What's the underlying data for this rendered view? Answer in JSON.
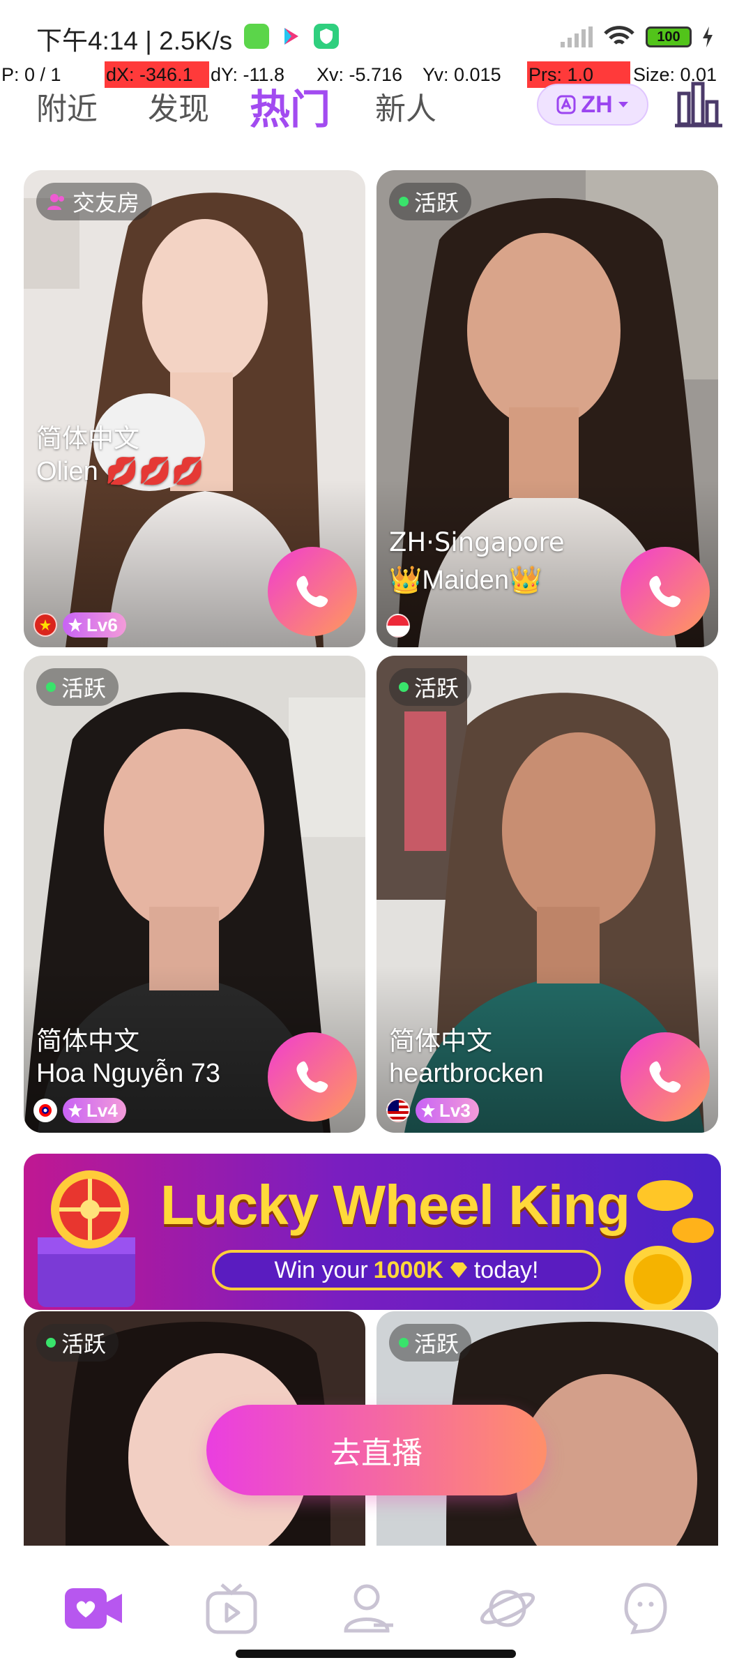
{
  "status_bar": {
    "time_rate": "下午4:14 | 2.5K/s",
    "battery": "100"
  },
  "debug": {
    "pointer": "P: 0 / 1",
    "dx": "dX: -346.1",
    "dy": "dY: -11.8",
    "xv": "Xv: -5.716",
    "yv": "Yv: 0.015",
    "prs": "Prs: 1.0",
    "size": "Size: 0.01"
  },
  "top_nav": {
    "tabs": [
      {
        "label": "附近",
        "active": false
      },
      {
        "label": "发现",
        "active": false
      },
      {
        "label": "热门",
        "active": true
      },
      {
        "label": "新人",
        "active": false
      }
    ],
    "language": "ZH"
  },
  "cards": [
    {
      "tag": "交友房",
      "tag_icon": "group-icon",
      "language": "简体中文",
      "name": "Olien 💋💋💋",
      "flag": "vietnam-flag",
      "level": "Lv6"
    },
    {
      "tag": "活跃",
      "tag_icon": "online-dot",
      "language": "ZH·Singapore",
      "name": "👑Maiden👑",
      "flag": "singapore-flag",
      "level": ""
    },
    {
      "tag": "活跃",
      "tag_icon": "online-dot",
      "language": "简体中文",
      "name": "Hoa Nguyễn 73",
      "flag": "taiwan-flag",
      "level": "Lv4"
    },
    {
      "tag": "活跃",
      "tag_icon": "online-dot",
      "language": "简体中文",
      "name": "heartbrocken",
      "flag": "malaysia-flag",
      "level": "Lv3"
    },
    {
      "tag": "活跃",
      "tag_icon": "online-dot",
      "language": "",
      "name": "",
      "flag": "",
      "level": ""
    },
    {
      "tag": "活跃",
      "tag_icon": "online-dot",
      "language": "",
      "name": "",
      "flag": "",
      "level": ""
    }
  ],
  "banner": {
    "title": "Lucky Wheel King",
    "subtitle_prefix": "Win your",
    "subtitle_amount": "1000K",
    "subtitle_suffix": "today!"
  },
  "live_button": "去直播",
  "bottom_nav": [
    {
      "icon": "video-call-icon",
      "active": true
    },
    {
      "icon": "tv-play-icon",
      "active": false
    },
    {
      "icon": "friends-icon",
      "active": false
    },
    {
      "icon": "planet-icon",
      "active": false
    },
    {
      "icon": "ghost-chat-icon",
      "active": false
    }
  ],
  "colors": {
    "accent": "#a24bf0",
    "call_gradient_start": "#f03dd0",
    "call_gradient_end": "#ff9a5a",
    "online_dot": "#39e36b"
  }
}
